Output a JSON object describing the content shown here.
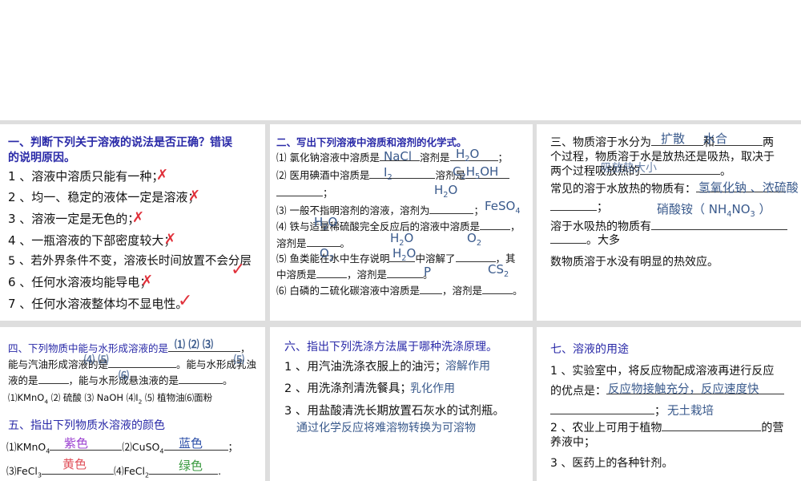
{
  "p1": {
    "title1": "一、判断下列关于溶液的说法是否正确？错误",
    "title2": "的说明原因。",
    "items": [
      "1 、溶液中溶质只能有一种；",
      "2 、均一、稳定的液体一定是溶液；",
      "3 、溶液一定是无色的；",
      "4 、一瓶溶液的下部密度较大；",
      "5 、若外界条件不变，溶液长时间放置不会分层",
      "6 、任何水溶液均能导电；",
      "7 、任何水溶液整体均不显电性。"
    ],
    "marks": [
      "✗",
      "✗",
      "✗",
      "✗",
      "✓",
      "✗",
      "✓"
    ]
  },
  "p2": {
    "title": "二、写出下列溶液中溶质和溶剂的化学式。",
    "l1a": "⑴ 氯化钠溶液中溶质是",
    "l1b": "溶剂是",
    "l1c": "；",
    "l2a": "⑵ 医用碘酒中溶质是",
    "l2b": "溶剂是",
    "l2c": "；",
    "l3a": "⑶ 一般不指明溶剂的溶液，溶剂为",
    "l3b": "；",
    "l4a": "⑷ 铁与适量稀硫酸完全反应后的溶液中溶质是",
    "l4b": "，",
    "l4c": "溶剂是",
    "l4d": "。",
    "l5a": "⑸ 鱼类能在水中生存说明",
    "l5b": "中溶解了",
    "l5c": "，其",
    "l5d": "中溶质是",
    "l5e": "，溶剂是",
    "l5f": "。",
    "l6a": "⑹ 白磷的二硫化碳溶液中溶质是",
    "l6b": "，溶剂是",
    "l6c": "。",
    "answers": {
      "a1": "NaCl",
      "a2": "H",
      "a2s": "2",
      "a2e": "O",
      "a3": "I",
      "a3s": "2",
      "a4": "C",
      "a4s": "2",
      "a4m": "H",
      "a4s2": "5",
      "a4e": "OH",
      "a5": "H",
      "a5s": "2",
      "a5e": "O",
      "a6": "FeSO",
      "a6s": "4",
      "a7": "H",
      "a7s": "2",
      "a7e": "O",
      "a8": "H",
      "a8s": "2",
      "a8e": "O",
      "a9": "O",
      "a9s": "2",
      "a10": "O",
      "a10s": "2",
      "a11": "H",
      "a11s": "2",
      "a11e": "O",
      "a12": "P",
      "a13": "CS",
      "a13s": "2"
    }
  },
  "p3": {
    "l1a": "三、物质溶于水分为",
    "l1b": "和",
    "l1c": "两",
    "l2": "个过程，物质溶于水是放热还是吸热，取决于",
    "l3a": "两个过程吸放热的",
    "l3b": "。",
    "l4a": "常见的溶于水放热的物质有：",
    "l5": "；",
    "l6a": "溶于水吸热的物质有",
    "l7": "。大多",
    "l8": "数物质溶于水没有明显的热效应。",
    "answers": {
      "a1": "扩散",
      "a2": "水合",
      "a3": "吸放热大小",
      "a4": "氢氧化钠 、浓硫酸",
      "a5a": "硝酸铵（ NH",
      "a5s": "4",
      "a5b": "NO",
      "a5s2": "3",
      "a5c": " ）"
    }
  },
  "p4": {
    "l1a": "四、下列物质中能与水形成溶液的是",
    "l1b": "，",
    "l2a": "能与汽油形成溶液的是",
    "l2b": "。能与水形成乳浊",
    "l3a": "液的是",
    "l3b": "，能与水形成悬浊液的是",
    "l3c": "。",
    "list": "⑴KMnO",
    "list_s": "4",
    "list2": " ⑵ 硫酸 ⑶ NaOH ⑷I",
    "list2_s": "2",
    "list3": " ⑸ 植物油⑹面粉",
    "title5": "五、指出下列物质水溶液的颜色",
    "c1": "⑴KMnO",
    "c1s": "4",
    "c2": "⑵CuSO",
    "c2s": "4",
    "c2e": "；",
    "c3": "⑶FeCl",
    "c3s": "3",
    "c4": "⑷FeCl",
    "c4s": "2",
    "c4e": ".",
    "answers": {
      "a1": "⑴ ⑵ ⑶",
      "a2": "⑷ ⑸",
      "a3": "⑸",
      "a4": "⑹",
      "k1": "紫色",
      "k2": "蓝色",
      "k3": "黄色",
      "k4": "绿色"
    },
    "colors": {
      "purple": "#9a3fd0",
      "blue": "#2c4fa8",
      "red": "#e0505a",
      "green": "#3a9a40"
    }
  },
  "p5": {
    "title": "六、指出下列洗涤方法属于哪种洗涤原理。",
    "l1": "1 、用汽油洗涤衣服上的油污；",
    "l2": "2 、用洗涤剂清洗餐具；",
    "l3": "3 、用盐酸清洗长期放置石灰水的试剂瓶。",
    "answers": {
      "a1": "溶解作用",
      "a2": "乳化作用",
      "a3": "通过化学反应将难溶物转换为可溶物"
    }
  },
  "p6": {
    "title": "七、溶液的用途",
    "l1": "1 、实验室中，将反应物配成溶液再进行反应",
    "l2": "的优点是：",
    "l3": "；",
    "l4a": "2 、农业上可用于植物",
    "l4b": "的营",
    "l5": "养液中；",
    "l6": "3 、医药上的各种针剂。",
    "answers": {
      "a1": "反应物接触充分，反应速度快",
      "a2": "无土栽培"
    }
  }
}
